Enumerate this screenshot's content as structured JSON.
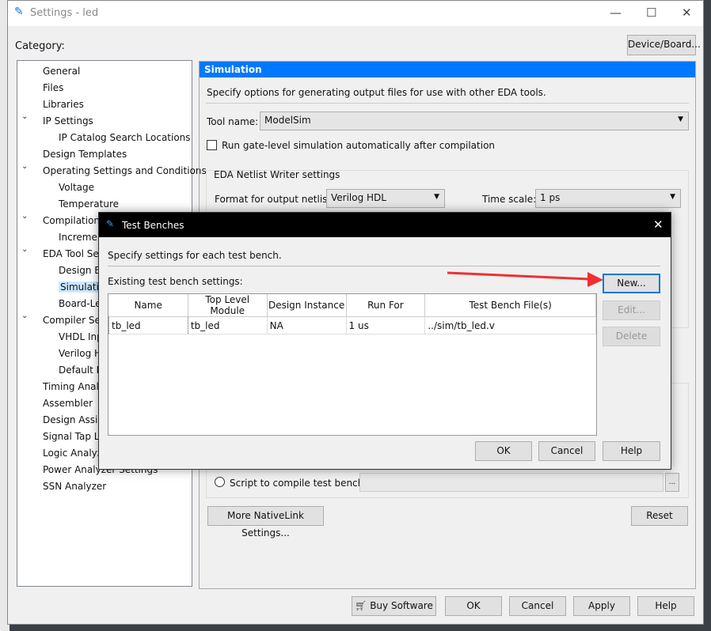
{
  "window": {
    "title": "Settings - led",
    "category_label": "Category:",
    "device_board_button": "Device/Board...",
    "minimize": "—",
    "maximize": "☐",
    "close": "✕"
  },
  "tree": [
    "General",
    "Files",
    "Libraries",
    "IP Settings",
    "IP Catalog Search Locations",
    "Design Templates",
    "Operating Settings and Conditions",
    "Voltage",
    "Temperature",
    "Compilation Process Settings",
    "Incremental Compilation",
    "EDA Tool Settings",
    "Design Entry/Synthesis",
    "Simulation",
    "Board-Level Timing Analysis",
    "Compiler Settings",
    "VHDL Input",
    "Verilog HDL Input",
    "Default Parameters",
    "Timing Analyzer",
    "Assembler",
    "Design Assistant",
    "Signal Tap Logic Analyzer",
    "Logic Analyzer Interface",
    "Power Analyzer Settings",
    "SSN Analyzer"
  ],
  "simulation": {
    "header": "Simulation",
    "description": "Specify options for generating output files for use with other EDA tools.",
    "tool_name_label": "Tool name:",
    "tool_name_value": "ModelSim",
    "gate_level_label": "Run gate-level simulation automatically after compilation",
    "gate_level_checked": false,
    "netlist_group": "EDA Netlist Writer settings",
    "format_label": "Format for output netlist:",
    "format_value": "Verilog HDL",
    "timescale_label": "Time scale:",
    "timescale_value": "1 ps",
    "script_label": "Script to compile test bench:",
    "script_value": "",
    "browse": "...",
    "more_nativelink": "More NativeLink Settings...",
    "reset": "Reset"
  },
  "footer": {
    "buy": "Buy Software",
    "ok": "OK",
    "cancel": "Cancel",
    "apply": "Apply",
    "help": "Help"
  },
  "dialog": {
    "title": "Test Benches",
    "description": "Specify settings for each test bench.",
    "existing_label": "Existing test bench settings:",
    "columns": [
      "Name",
      "Top Level Module",
      "Design Instance",
      "Run For",
      "Test Bench File(s)"
    ],
    "rows": [
      [
        "tb_led",
        "tb_led",
        "NA",
        "1 us",
        "../sim/tb_led.v"
      ]
    ],
    "new": "New...",
    "edit": "Edit...",
    "delete": "Delete",
    "ok": "OK",
    "cancel": "Cancel",
    "help": "Help",
    "close": "✕"
  },
  "colors": {
    "accent": "#0078fd",
    "arrow": "#f03030"
  }
}
